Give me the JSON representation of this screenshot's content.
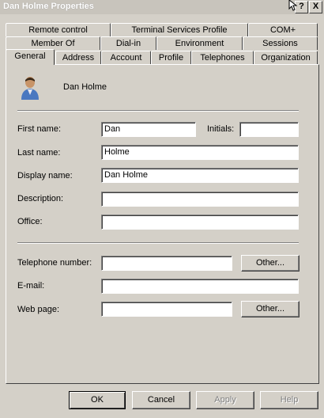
{
  "window": {
    "title": "Dan Holme Properties",
    "help_label": "?",
    "close_label": "X"
  },
  "tabs": {
    "row1": [
      "Remote control",
      "Terminal Services Profile",
      "COM+"
    ],
    "row2": [
      "Member Of",
      "Dial-in",
      "Environment",
      "Sessions"
    ],
    "row3": [
      "General",
      "Address",
      "Account",
      "Profile",
      "Telephones",
      "Organization"
    ],
    "active": "General"
  },
  "general": {
    "user_display": "Dan Holme",
    "first_name_label": "First name:",
    "first_name_value": "Dan",
    "initials_label": "Initials:",
    "initials_value": "",
    "last_name_label": "Last name:",
    "last_name_value": "Holme",
    "display_name_label": "Display name:",
    "display_name_value": "Dan Holme",
    "description_label": "Description:",
    "description_value": "",
    "office_label": "Office:",
    "office_value": "",
    "telephone_label": "Telephone number:",
    "telephone_value": "",
    "email_label": "E-mail:",
    "email_value": "",
    "webpage_label": "Web page:",
    "webpage_value": "",
    "other_label": "Other..."
  },
  "buttons": {
    "ok": "OK",
    "cancel": "Cancel",
    "apply": "Apply",
    "help": "Help"
  }
}
